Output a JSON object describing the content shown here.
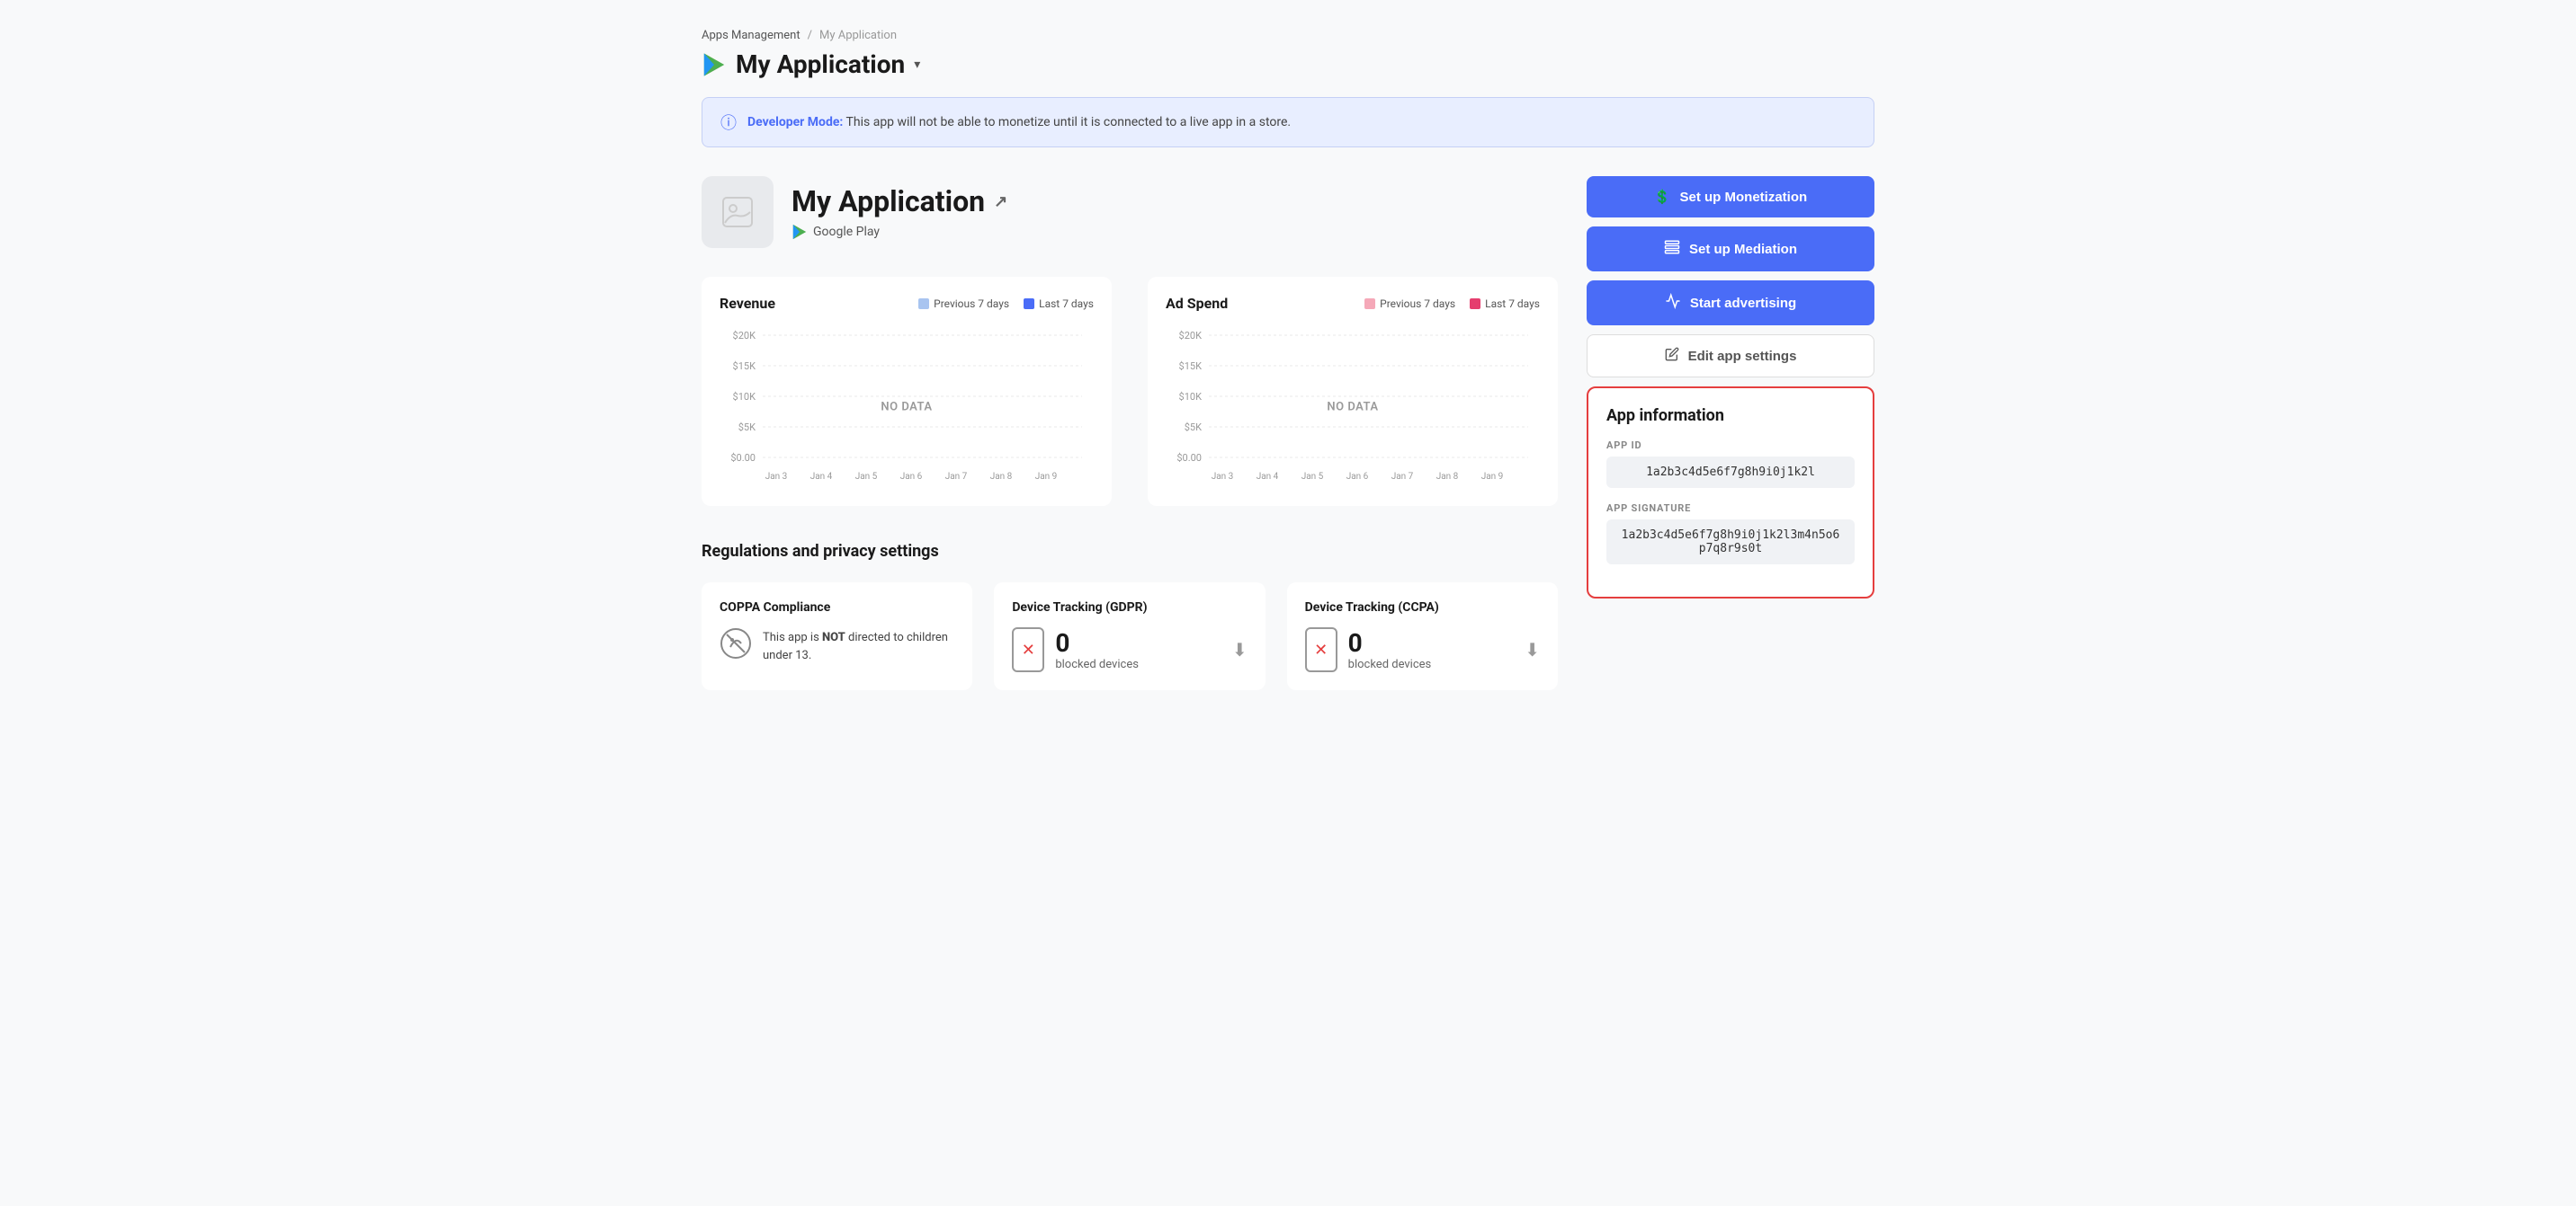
{
  "breadcrumb": {
    "parent": "Apps Management",
    "separator": "/",
    "current": "My Application"
  },
  "app_title": "My Application",
  "developer_banner": {
    "label": "Developer Mode:",
    "message": "This app will not be able to monetize until it is connected to a live app in a store."
  },
  "app_header": {
    "name": "My Application",
    "store": "Google Play"
  },
  "revenue_chart": {
    "title": "Revenue",
    "legend_previous": "Previous 7 days",
    "legend_last": "Last 7 days",
    "prev_color": "#a8c4f0",
    "last_color": "#4a6cf7",
    "no_data": "NO DATA",
    "y_labels": [
      "$20K",
      "$15K",
      "$10K",
      "$5K",
      "$0.00"
    ],
    "x_labels": [
      "Jan 3",
      "Jan 4",
      "Jan 5",
      "Jan 6",
      "Jan 7",
      "Jan 8",
      "Jan 9"
    ]
  },
  "adspend_chart": {
    "title": "Ad Spend",
    "legend_previous": "Previous 7 days",
    "legend_last": "Last 7 days",
    "prev_color": "#f5a8b8",
    "last_color": "#e53e6e",
    "no_data": "NO DATA",
    "y_labels": [
      "$20K",
      "$15K",
      "$10K",
      "$5K",
      "$0.00"
    ],
    "x_labels": [
      "Jan 3",
      "Jan 4",
      "Jan 5",
      "Jan 6",
      "Jan 7",
      "Jan 8",
      "Jan 9"
    ]
  },
  "buttons": {
    "monetization": "Set up Monetization",
    "mediation": "Set up Mediation",
    "advertising": "Start advertising",
    "edit_settings": "Edit app settings"
  },
  "app_information": {
    "title": "App information",
    "app_id_label": "APP ID",
    "app_id_value": "1a2b3c4d5e6f7g8h9i0j1k2l",
    "app_signature_label": "APP SIGNATURE",
    "app_signature_value": "1a2b3c4d5e6f7g8h9i0j1k2l3m4n5o6p7q8r9s0t"
  },
  "regulations": {
    "title": "Regulations and privacy settings",
    "coppa": {
      "title": "COPPA Compliance",
      "text_before": "This app is ",
      "text_bold": "NOT",
      "text_after": " directed to children under 13."
    },
    "gdpr": {
      "title": "Device Tracking (GDPR)",
      "count": "0",
      "label": "blocked devices"
    },
    "ccpa": {
      "title": "Device Tracking (CCPA)",
      "count": "0",
      "label": "blocked devices"
    }
  }
}
